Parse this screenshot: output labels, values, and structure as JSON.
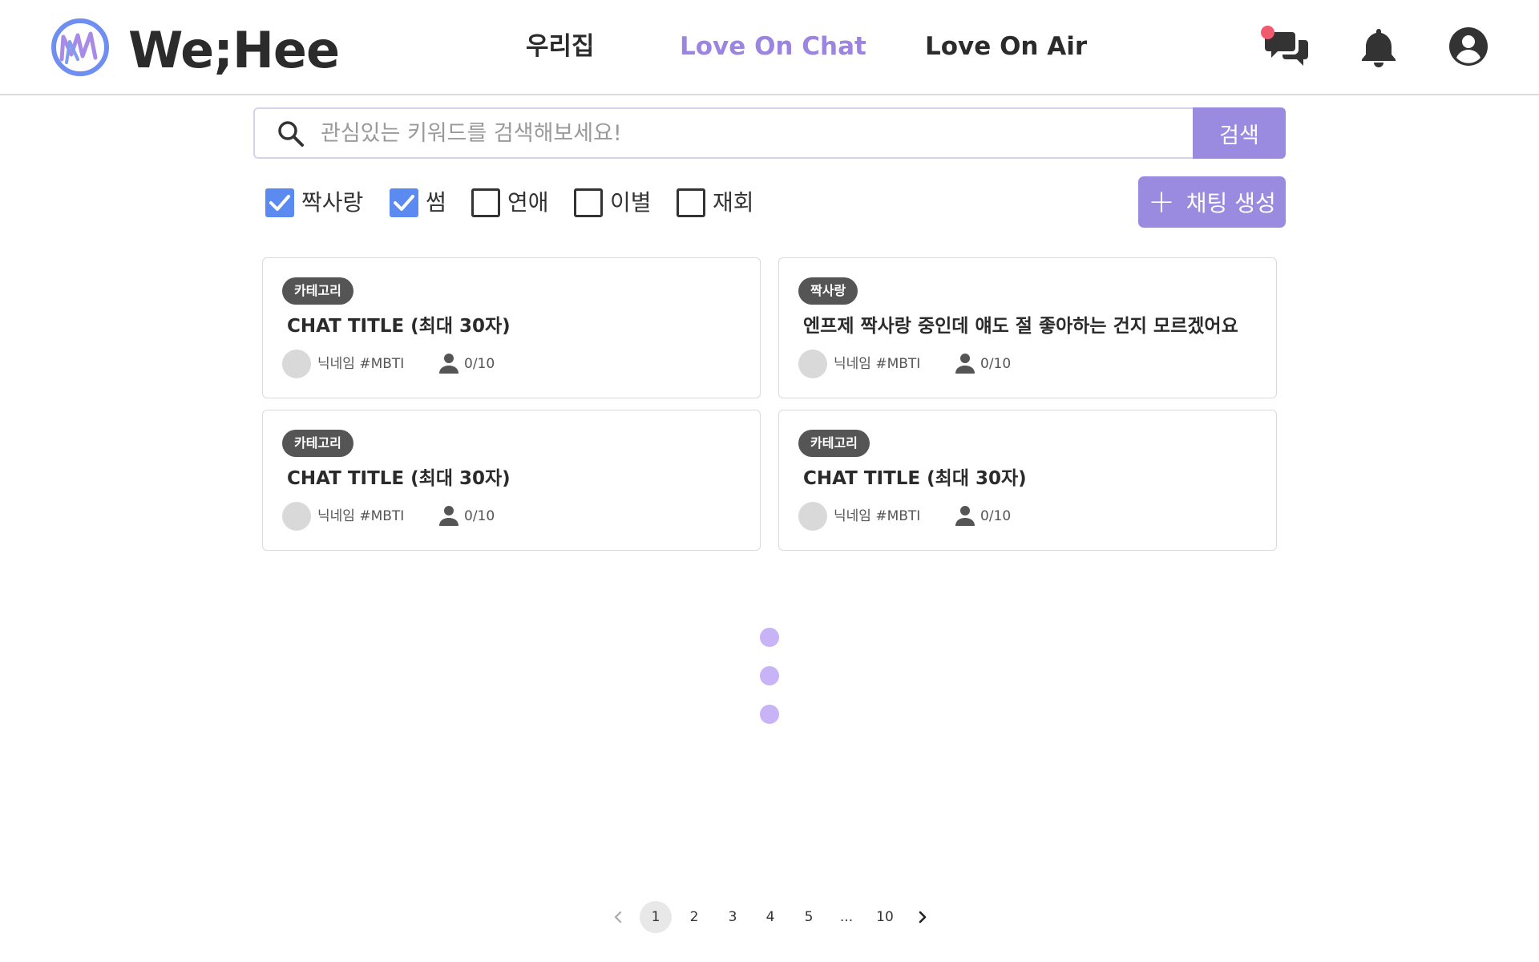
{
  "brand": {
    "name": "We;Hee"
  },
  "nav": [
    {
      "label": "우리집",
      "active": false
    },
    {
      "label": "Love On Chat",
      "active": true
    },
    {
      "label": "Love On Air",
      "active": false
    }
  ],
  "header_icons": [
    "chat-bubbles-icon",
    "bell-icon",
    "account-icon"
  ],
  "search": {
    "placeholder": "관심있는 키워드를 검색해보세요!",
    "value": "",
    "button_label": "검색"
  },
  "filters": [
    {
      "label": "짝사랑",
      "checked": true
    },
    {
      "label": "썸",
      "checked": true
    },
    {
      "label": "연애",
      "checked": false
    },
    {
      "label": "이별",
      "checked": false
    },
    {
      "label": "재회",
      "checked": false
    }
  ],
  "create_button": {
    "label": "채팅 생성"
  },
  "cards": [
    {
      "category": "카테고리",
      "title": "CHAT TITLE  (최대 30자)",
      "author": "닉네임 #MBTI",
      "count": "0/10"
    },
    {
      "category": "짝사랑",
      "title": "엔프제 짝사랑 중인데 얘도 절 좋아하는 건지 모르겠어요",
      "author": "닉네임 #MBTI",
      "count": "0/10"
    },
    {
      "category": "카테고리",
      "title": "CHAT TITLE  (최대 30자)",
      "author": "닉네임 #MBTI",
      "count": "0/10"
    },
    {
      "category": "카테고리",
      "title": "CHAT TITLE  (최대 30자)",
      "author": "닉네임 #MBTI",
      "count": "0/10"
    }
  ],
  "pagination": {
    "pages": [
      "1",
      "2",
      "3",
      "4",
      "5",
      "...",
      "10"
    ],
    "current": "1"
  },
  "colors": {
    "accent": "#9b8be0",
    "nav_active": "#9b85e0",
    "checkbox": "#5b8bf0",
    "notification": "#f05a6e",
    "loading_dot": "#c7b3f5",
    "badge": "#555555"
  }
}
